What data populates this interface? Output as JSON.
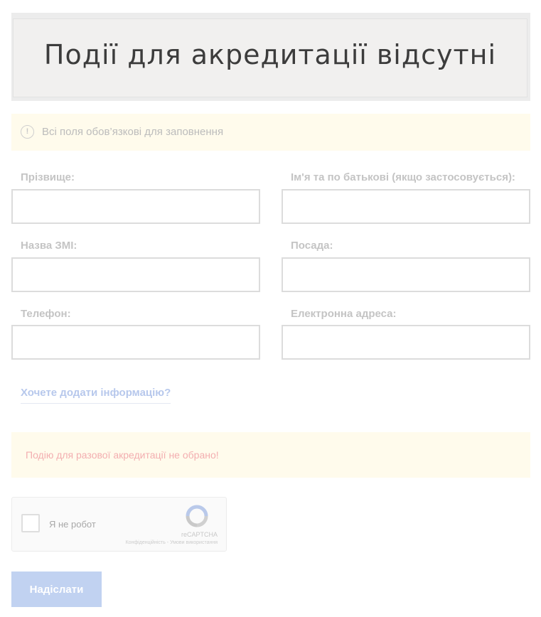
{
  "banner": {
    "title": "Події для акредитації відсутні"
  },
  "notice": {
    "icon": "exclamation-circle-icon",
    "text": "Всі поля обов’язкові для заповнення"
  },
  "form": {
    "surname_label": "Прізвище:",
    "surname_value": "",
    "name_label": "Ім'я та по батькові (якщо застосовується):",
    "name_value": "",
    "media_label": "Назва ЗМІ:",
    "media_value": "",
    "position_label": "Посада:",
    "position_value": "",
    "phone_label": "Телефон:",
    "phone_value": "",
    "email_label": "Електронна адреса:",
    "email_value": ""
  },
  "more_info_link": "Хочете додати інформацію?",
  "warning": {
    "text": "Подію для разової акредитації не обрано!"
  },
  "captcha": {
    "label": "Я не робот",
    "brand": "reCAPTCHA",
    "links": "Конфіденційність - Умови використання",
    "checked": false
  },
  "submit_label": "Надіслати",
  "colors": {
    "notice_bg": "#fffbec",
    "link": "#b7c8ec",
    "warning_text": "#f3aeb0",
    "submit_bg": "#c1d2f1"
  }
}
